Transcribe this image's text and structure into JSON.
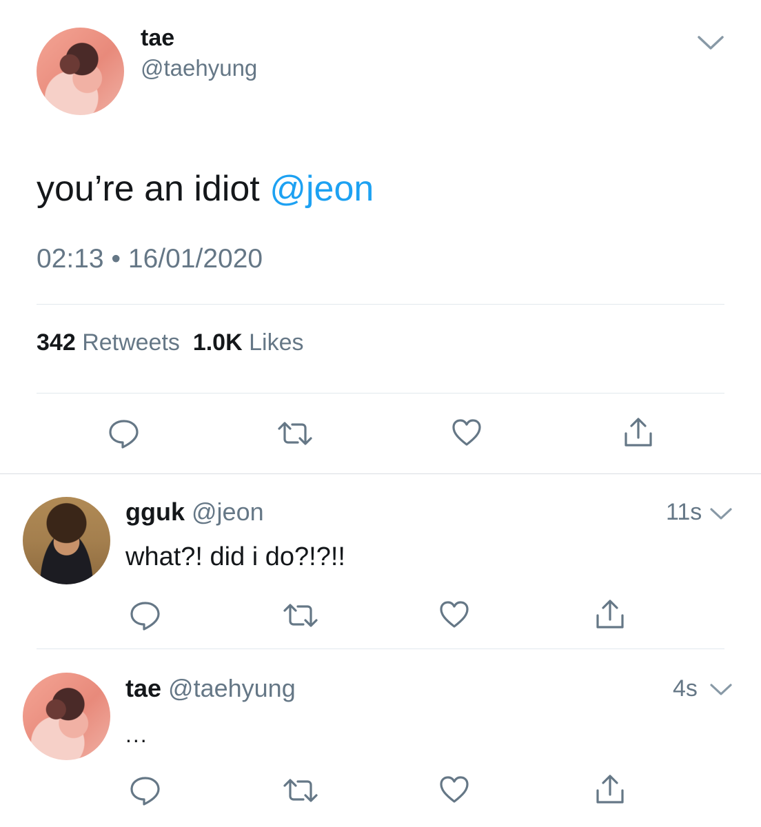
{
  "main_tweet": {
    "display_name": "tae",
    "handle": "@taehyung",
    "text_plain": "you’re an idiot ",
    "text_mention": "@jeon",
    "timestamp": "02:13 • 16/01/2020",
    "retweet_count": "342",
    "retweets_label": "Retweets",
    "like_count": "1.0K",
    "likes_label": "Likes"
  },
  "replies": [
    {
      "display_name": "gguk",
      "handle": "@jeon",
      "time": "11s",
      "text": "what?! did i do?!?!!"
    },
    {
      "display_name": "tae",
      "handle": "@taehyung",
      "time": "4s",
      "text": "..."
    }
  ],
  "icons": {
    "reply": "speech-bubble-icon",
    "retweet": "retweet-icon",
    "like": "heart-icon",
    "share": "share-icon",
    "menu": "chevron-down-icon"
  },
  "colors": {
    "text": "#14171a",
    "muted": "#657786",
    "mention": "#1da1f2",
    "divider": "#e1e8ed"
  }
}
